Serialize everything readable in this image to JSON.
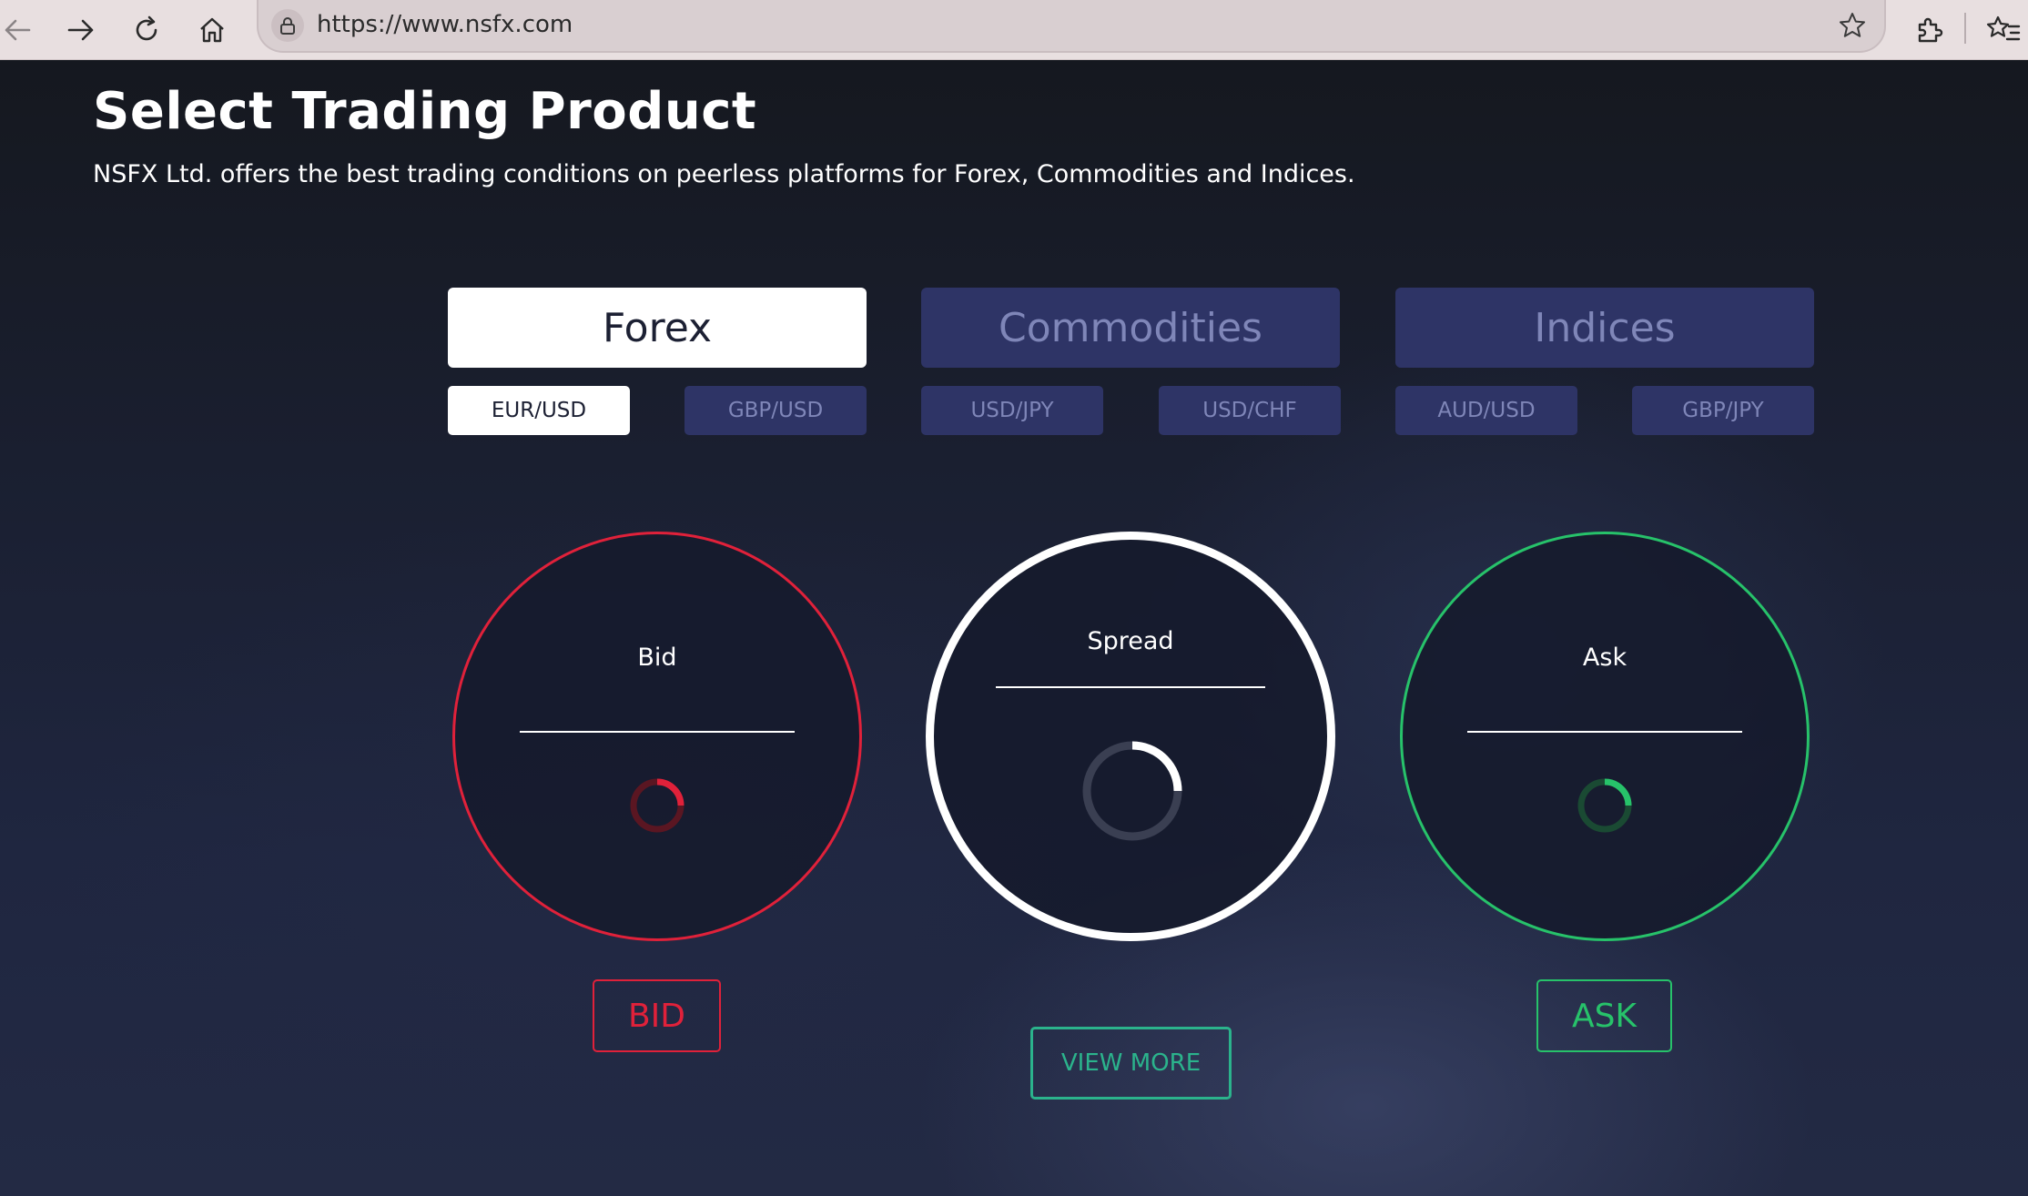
{
  "browser": {
    "url": "https://www.nsfx.com"
  },
  "header": {
    "title": "Select Trading Product",
    "subtitle": "NSFX Ltd. offers the best trading conditions on peerless platforms for Forex, Commodities and Indices."
  },
  "categories": [
    {
      "label": "Forex",
      "active": true
    },
    {
      "label": "Commodities",
      "active": false
    },
    {
      "label": "Indices",
      "active": false
    }
  ],
  "pairs": [
    {
      "label": "EUR/USD",
      "active": true
    },
    {
      "label": "GBP/USD",
      "active": false
    },
    {
      "label": "USD/JPY",
      "active": false
    },
    {
      "label": "USD/CHF",
      "active": false
    },
    {
      "label": "AUD/USD",
      "active": false
    },
    {
      "label": "GBP/JPY",
      "active": false
    }
  ],
  "quotes": {
    "bid": {
      "label": "Bid",
      "button": "BID",
      "color": "#e0213a"
    },
    "spread": {
      "label": "Spread",
      "color": "#ffffff"
    },
    "ask": {
      "label": "Ask",
      "button": "ASK",
      "color": "#27c26a"
    }
  },
  "view_more": {
    "label": "VIEW MORE",
    "color": "#2bb38c"
  },
  "icons": {
    "back": "arrow-left-icon",
    "forward": "arrow-right-icon",
    "reload": "reload-icon",
    "home": "home-icon",
    "lock": "lock-icon",
    "star": "star-icon",
    "extensions": "puzzle-icon",
    "favorites": "favorites-icon"
  }
}
